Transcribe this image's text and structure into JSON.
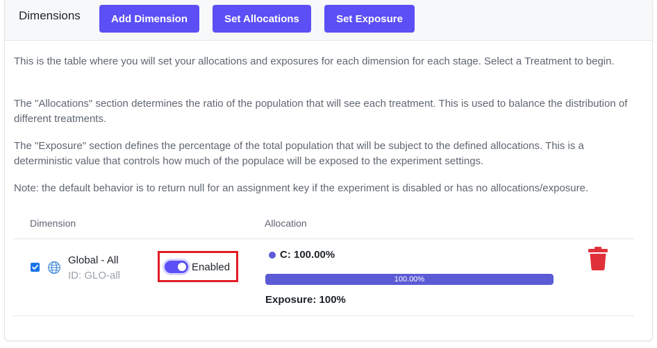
{
  "header": {
    "title": "Dimensions",
    "buttons": {
      "add_dimension": "Add Dimension",
      "set_allocations": "Set Allocations",
      "set_exposure": "Set Exposure"
    }
  },
  "description": {
    "p1": "This is the table where you will set your allocations and exposures for each dimension for each stage. Select a Treatment to begin.",
    "p2": "The \"Allocations\" section determines the ratio of the population that will see each treatment. This is used to balance the distribution of different treatments.",
    "p3": "The \"Exposure\" section defines the percentage of the total population that will be subject to the defined allocations. This is a deterministic value that controls how much of the populace will be exposed to the experiment settings.",
    "p4": "Note: the default behavior is to return null for an assignment key if the experiment is disabled or has no allocations/exposure."
  },
  "table": {
    "columns": [
      "Dimension",
      "Allocation"
    ],
    "rows": [
      {
        "checked": true,
        "icon": "globe-icon",
        "name": "Global - All",
        "id_text": "ID: GLO-all",
        "toggle_enabled": true,
        "toggle_label": "Enabled",
        "allocation_label": "C: 100.00%",
        "allocation_percent": 100,
        "progress_text": "100.00%",
        "exposure_text": "Exposure: 100%"
      }
    ]
  },
  "colors": {
    "accent": "#5b4ff5",
    "allocation": "#5b5bd6",
    "delete": "#e0313b",
    "highlight": "#e21b23"
  }
}
